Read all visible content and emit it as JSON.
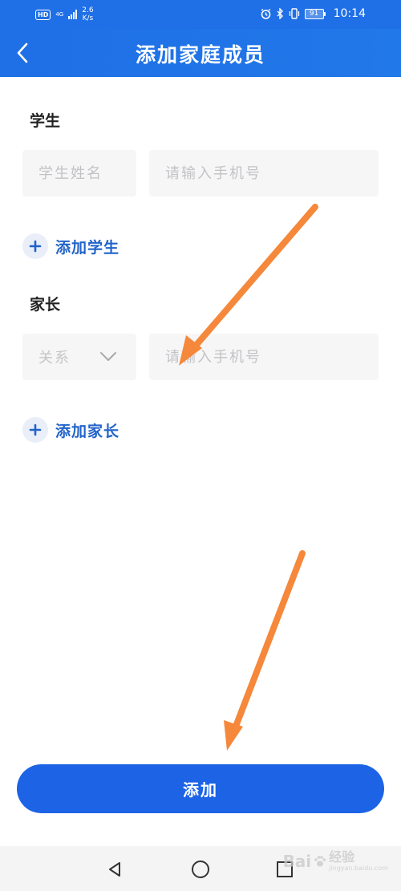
{
  "status_bar": {
    "hd": "HD",
    "network": "4G",
    "speed_value": "2.6",
    "speed_unit": "K/s",
    "battery": "91",
    "time": "10:14",
    "icons": [
      "alarm-icon",
      "bluetooth-icon",
      "vibrate-icon"
    ]
  },
  "header": {
    "title": "添加家庭成员",
    "back_icon": "chevron-left-icon"
  },
  "student_section": {
    "title": "学生",
    "name_placeholder": "学生姓名",
    "phone_placeholder": "请输入手机号",
    "add_label": "添加学生"
  },
  "parent_section": {
    "title": "家长",
    "relation_placeholder": "关系",
    "phone_placeholder": "请输入手机号",
    "add_label": "添加家长"
  },
  "submit_label": "添加",
  "nav_bar": [
    "back-triangle-icon",
    "home-circle-icon",
    "recents-square-icon"
  ],
  "watermark": {
    "logo": "Bai",
    "cn": "经验",
    "url": "jingyan.baidu.com"
  },
  "colors": {
    "primary": "#1c63e6",
    "header": "#1f6fe6",
    "link": "#2264c9",
    "annotation": "#f5883a"
  }
}
